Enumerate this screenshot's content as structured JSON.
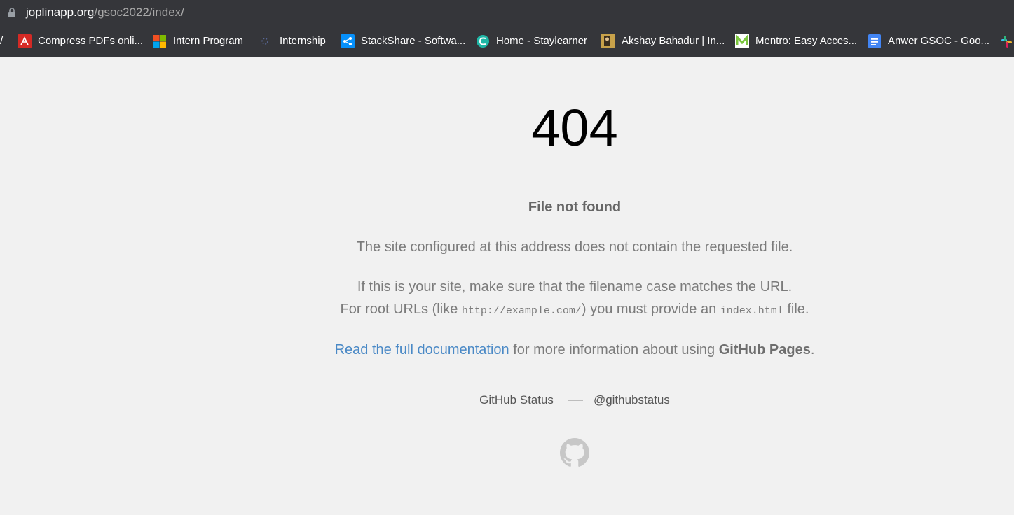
{
  "browser": {
    "url_host": "joplinapp.org",
    "url_path": "/gsoc2022/index/",
    "bookmarks": [
      {
        "label": "/",
        "icon": "folder-icon"
      },
      {
        "label": "Compress PDFs onli...",
        "icon": "pdf-icon"
      },
      {
        "label": "Intern Program",
        "icon": "microsoft-icon"
      },
      {
        "label": "Internship",
        "icon": "spinner-icon"
      },
      {
        "label": "StackShare - Softwa...",
        "icon": "share-icon"
      },
      {
        "label": "Home - Staylearner",
        "icon": "staylearner-icon"
      },
      {
        "label": "Akshay Bahadur | In...",
        "icon": "photo-icon"
      },
      {
        "label": "Mentro: Easy Acces...",
        "icon": "mentro-icon"
      },
      {
        "label": "Anwer GSOC - Goo...",
        "icon": "docs-icon"
      }
    ]
  },
  "page": {
    "error_code": "404",
    "headline": "File not found",
    "p1": "The site configured at this address does not contain the requested file.",
    "p2_line1": "If this is your site, make sure that the filename case matches the URL.",
    "p2_line2_a": "For root URLs (like ",
    "p2_code1": "http://example.com/",
    "p2_line2_b": ") you must provide an ",
    "p2_code2": "index.html",
    "p2_line2_c": " file.",
    "doc_link": "Read the full documentation",
    "doc_text": " for more information about using ",
    "doc_strong": "GitHub Pages",
    "doc_end": ".",
    "footer_status": "GitHub Status",
    "footer_twitter": "@githubstatus"
  },
  "colors": {
    "link": "#4a89c6",
    "background": "#f1f1f1",
    "toolbar": "#35363a"
  }
}
